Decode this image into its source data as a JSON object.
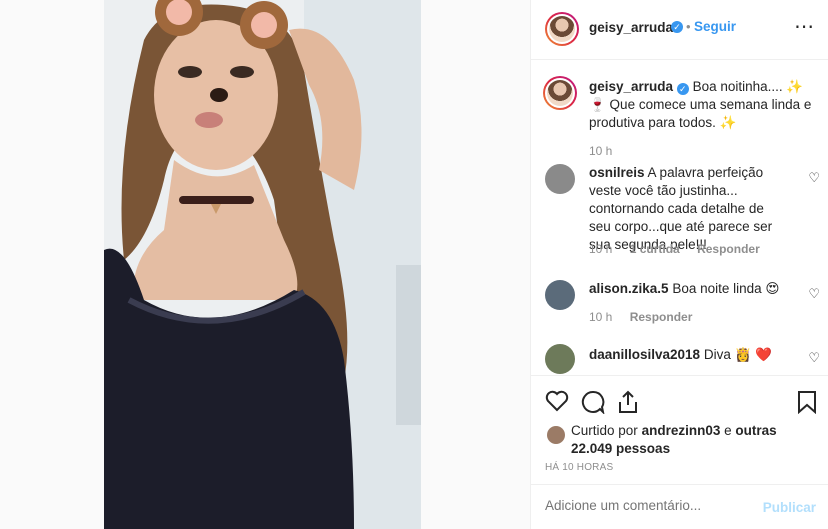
{
  "header": {
    "username": "geisy_arruda",
    "dot": "•",
    "follow": "Seguir",
    "more": "⋯"
  },
  "caption": {
    "username": "geisy_arruda",
    "text": "Boa noitinha.... ✨🍷 Que comece uma semana linda e produtiva para todos. ✨",
    "time": "10 h"
  },
  "comments": [
    {
      "username": "osnilreis",
      "text": "A palavra perfeição veste você tão justinha... contornando cada detalhe de seu corpo...que até parece ser sua segunda pele!!!",
      "time": "10 h",
      "likes": "1 curtida",
      "reply": "Responder"
    },
    {
      "username": "alison.zika.5",
      "text": "Boa noite linda 😍",
      "time": "10 h",
      "reply": "Responder"
    },
    {
      "username": "daanillosilva2018",
      "text": "Diva 👸 ❤️"
    }
  ],
  "likes": {
    "prefix": "Curtido por",
    "user": "andrezinn03",
    "and": "e",
    "others": "outras 22.049 pessoas"
  },
  "timestamp": "HÁ 10 HORAS",
  "comment_box": {
    "placeholder": "Adicione um comentário...",
    "publish": "Publicar"
  },
  "colors": {
    "accent": "#3897f0",
    "text": "#262626",
    "muted": "#8e8e8e",
    "border": "#efefef"
  }
}
